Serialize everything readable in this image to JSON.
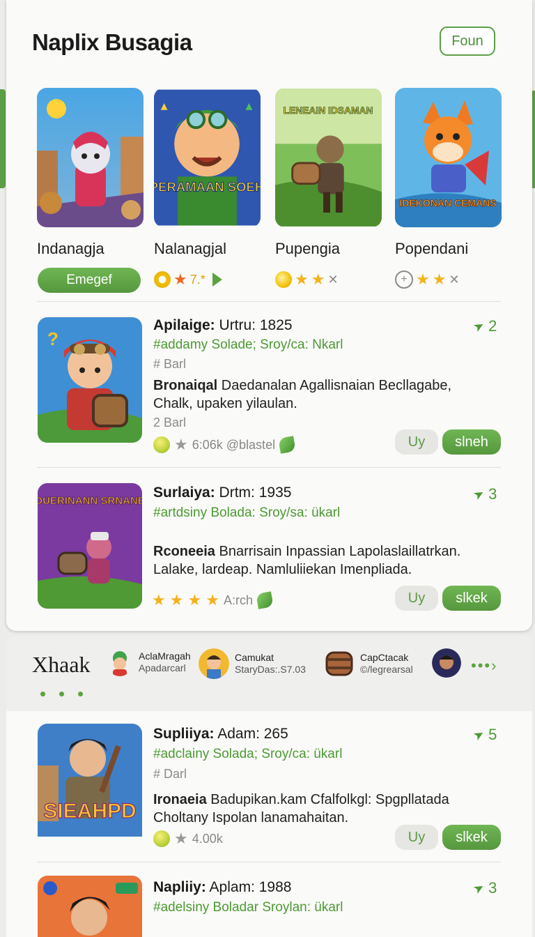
{
  "header": {
    "title": "Naplix Busagia",
    "action_label": "Foun"
  },
  "featured": [
    {
      "name": "Indanagja",
      "button_label": "Emegef"
    },
    {
      "name": "Nalanagjal",
      "rating_text": "7.*",
      "poster_text": "PERAMAAN SOEH"
    },
    {
      "name": "Pupengia",
      "poster_text": "LENEAIN IDSAMAN"
    },
    {
      "name": "Popendani",
      "poster_text": "IDEKONAN CEMANS"
    }
  ],
  "list": [
    {
      "title_bold": "Apilaige:",
      "title_rest": " Urtru: 1825",
      "tags": "#addamy Solade; Sroy/ca: Nkarl",
      "hash": "# Barl",
      "desc_bold": "Bronaiqal",
      "desc_rest": " Daedanalan Agallisnaian Becllagabe, Chalk, upaken yilaulan.",
      "hash2": "2 Barl",
      "meta": "6:06k @blastel",
      "rank": "2",
      "btn1": "Uy",
      "btn2": "slneh"
    },
    {
      "title_bold": "Surlaiya:",
      "title_rest": " Drtm: 1935",
      "tags": "#artdsiny Bolada: Sroy/sa: ükarl",
      "desc_bold": "Rconeeia",
      "desc_rest": " Bnarrisain Inpassian Lapolaslaillatrkan. Lalake, lardeap. Namluliiekan Imenpliada.",
      "meta": "A:rch",
      "poster_text": "DUERINANN SRNANE",
      "rank": "3",
      "btn1": "Uy",
      "btn2": "slkek"
    },
    {
      "title_bold": "Supliiya:",
      "title_rest": " Adam: 265",
      "tags": "#adclainy Solada; Sroy/ca: ükarl",
      "hash": "# Darl",
      "desc_bold": "Ironaeia",
      "desc_rest": " Badupikan.kam Cfalfolkgl: Spgpllatada Choltany Ispolan lanamahaitan.",
      "meta": "4.00k",
      "poster_text": "SIEAHPD",
      "rank": "5",
      "btn1": "Uy",
      "btn2": "slkek"
    },
    {
      "title_bold": "Napliiy:",
      "title_rest": " Aplam: 1988",
      "tags": "#adelsiny Boladar Sroylan: ükarl",
      "rank": "3"
    }
  ],
  "strip": {
    "title": "Xhaak",
    "pills": [
      {
        "line1": "AclaMragah",
        "line2": "Apadarcarl"
      },
      {
        "line1": "Camukat",
        "line2": "StaryDas:.S7.03"
      },
      {
        "line1": "CapCtacak",
        "line2": "©/legrearsal"
      }
    ]
  },
  "colors": {
    "accent": "#5c9e46",
    "card": "#fafaf8",
    "background": "#ececea"
  }
}
